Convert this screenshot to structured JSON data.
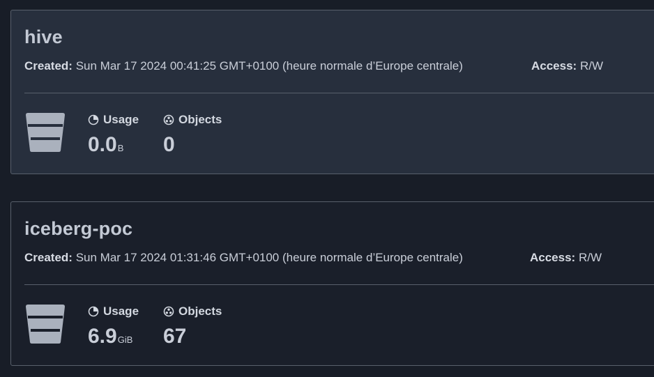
{
  "labels": {
    "created": "Created:",
    "access": "Access:",
    "usage": "Usage",
    "objects": "Objects"
  },
  "buckets": [
    {
      "name": "hive",
      "created": "Sun Mar 17 2024 00:41:25 GMT+0100 (heure normale d’Europe centrale)",
      "access": "R/W",
      "usage_value": "0.0",
      "usage_unit": "B",
      "objects": "0"
    },
    {
      "name": "iceberg-poc",
      "created": "Sun Mar 17 2024 01:31:46 GMT+0100 (heure normale d’Europe centrale)",
      "access": "R/W",
      "usage_value": "6.9",
      "usage_unit": "GiB",
      "objects": "67"
    }
  ],
  "icons": {
    "bucket": "bucket-icon",
    "usage": "pie-chart-icon",
    "objects": "objects-icon"
  },
  "colors": {
    "background": "#181d27",
    "card_hover": "#272f3d",
    "card": "#1a1f2a",
    "border": "#59606c",
    "text": "#c9ced8",
    "icon": "#aab1bd"
  }
}
